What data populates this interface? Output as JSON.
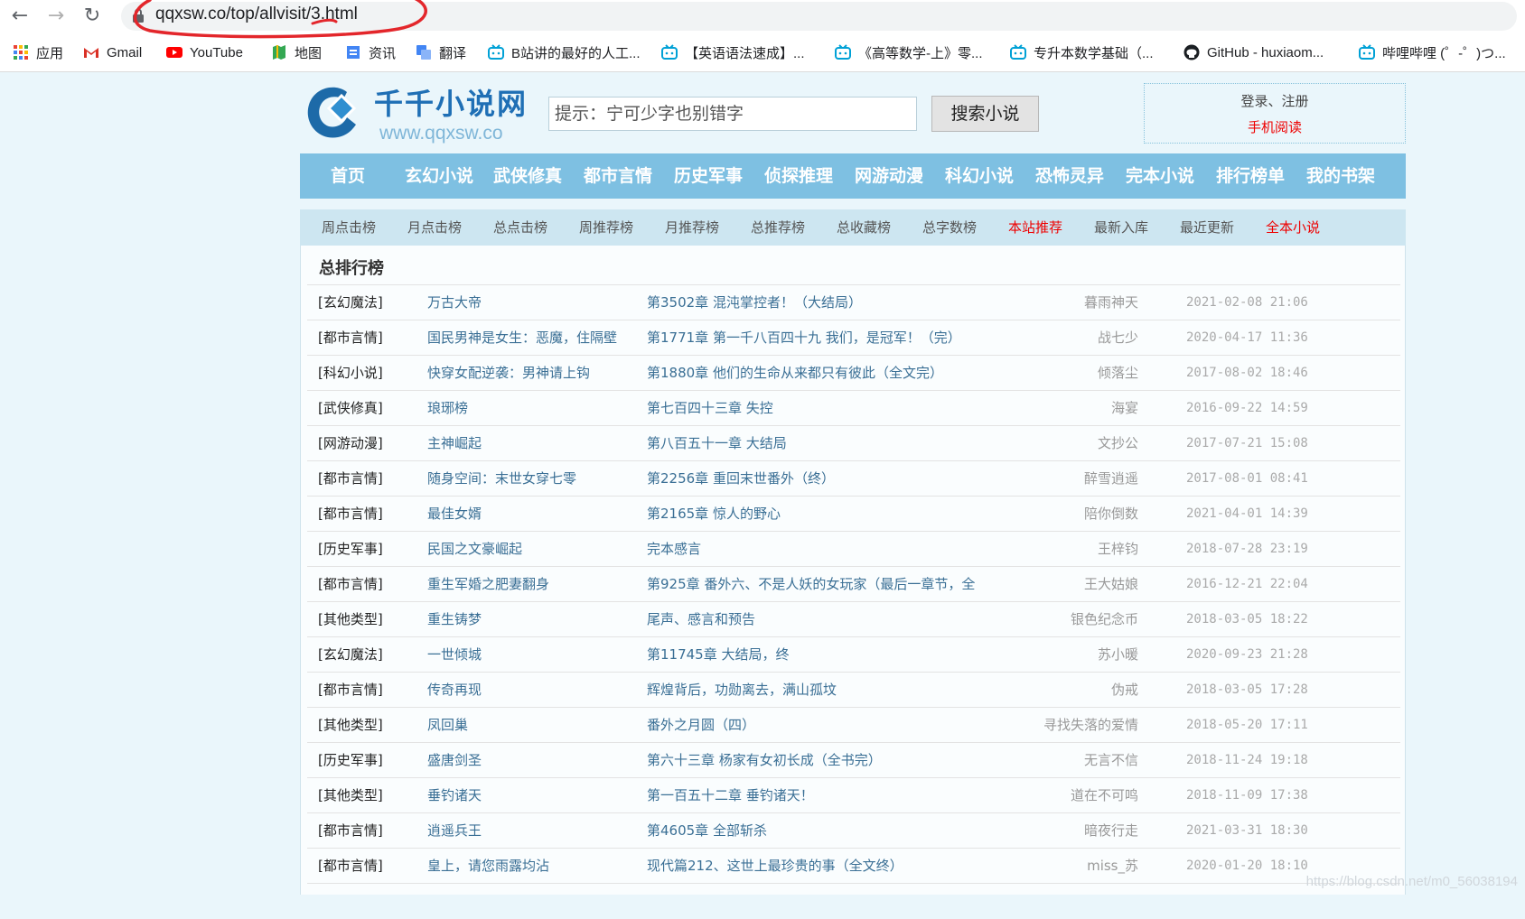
{
  "browser": {
    "url": "qqxsw.co/top/allvisit/3.html",
    "bookmarks": [
      "应用",
      "Gmail",
      "YouTube",
      "地图",
      "资讯",
      "翻译",
      "B站讲的最好的人工...",
      "【英语语法速成】...",
      "《高等数学-上》零...",
      "专升本数学基础（...",
      "GitHub - huxiaom...",
      "哔哩哔哩 (゜-゜)つ..."
    ]
  },
  "header": {
    "site_name": "千千小说网",
    "site_url": "www.qqxsw.co",
    "search_placeholder": "提示：宁可少字也别错字",
    "search_button": "搜索小说",
    "login_register": "登录、注册",
    "mobile_read": "手机阅读"
  },
  "main_nav": [
    "首页",
    "玄幻小说",
    "武侠修真",
    "都市言情",
    "历史军事",
    "侦探推理",
    "网游动漫",
    "科幻小说",
    "恐怖灵异",
    "完本小说",
    "排行榜单",
    "我的书架"
  ],
  "sub_nav": [
    "周点击榜",
    "月点击榜",
    "总点击榜",
    "周推荐榜",
    "月推荐榜",
    "总推荐榜",
    "总收藏榜",
    "总字数榜",
    "本站推荐",
    "最新入库",
    "最近更新",
    "全本小说"
  ],
  "ranking": {
    "title": "总排行榜",
    "rows": [
      {
        "cat": "[玄幻魔法]",
        "title": "万古大帝",
        "chapter": "第3502章 混沌掌控者！（大结局）",
        "author": "暮雨神天",
        "time": "2021-02-08 21:06"
      },
      {
        "cat": "[都市言情]",
        "title": "国民男神是女生：恶魔，住隔壁",
        "chapter": "第1771章 第一千八百四十九 我们，是冠军！（完）",
        "author": "战七少",
        "time": "2020-04-17 11:36"
      },
      {
        "cat": "[科幻小说]",
        "title": "快穿女配逆袭：男神请上钩",
        "chapter": "第1880章 他们的生命从来都只有彼此（全文完）",
        "author": "倾落尘",
        "time": "2017-08-02 18:46"
      },
      {
        "cat": "[武侠修真]",
        "title": "琅琊榜",
        "chapter": "第七百四十三章 失控",
        "author": "海宴",
        "time": "2016-09-22 14:59"
      },
      {
        "cat": "[网游动漫]",
        "title": "主神崛起",
        "chapter": "第八百五十一章 大结局",
        "author": "文抄公",
        "time": "2017-07-21 15:08"
      },
      {
        "cat": "[都市言情]",
        "title": "随身空间：末世女穿七零",
        "chapter": "第2256章 重回末世番外（终）",
        "author": "醉雪逍遥",
        "time": "2017-08-01 08:41"
      },
      {
        "cat": "[都市言情]",
        "title": "最佳女婿",
        "chapter": "第2165章 惊人的野心",
        "author": "陪你倒数",
        "time": "2021-04-01 14:39"
      },
      {
        "cat": "[历史军事]",
        "title": "民国之文豪崛起",
        "chapter": "完本感言",
        "author": "王梓钧",
        "time": "2018-07-28 23:19"
      },
      {
        "cat": "[都市言情]",
        "title": "重生军婚之肥妻翻身",
        "chapter": "第925章 番外六、不是人妖的女玩家（最后一章节，全",
        "author": "王大姑娘",
        "time": "2016-12-21 22:04"
      },
      {
        "cat": "[其他类型]",
        "title": "重生铸梦",
        "chapter": "尾声、感言和预告",
        "author": "银色纪念币",
        "time": "2018-03-05 18:22"
      },
      {
        "cat": "[玄幻魔法]",
        "title": "一世倾城",
        "chapter": "第11745章 大结局，终",
        "author": "苏小暖",
        "time": "2020-09-23 21:28"
      },
      {
        "cat": "[都市言情]",
        "title": "传奇再现",
        "chapter": "辉煌背后，功勋离去，满山孤坟",
        "author": "伪戒",
        "time": "2018-03-05 17:28"
      },
      {
        "cat": "[其他类型]",
        "title": "凤回巢",
        "chapter": "番外之月圆（四）",
        "author": "寻找失落的爱情",
        "time": "2018-05-20 17:11"
      },
      {
        "cat": "[历史军事]",
        "title": "盛唐剑圣",
        "chapter": "第六十三章 杨家有女初长成（全书完）",
        "author": "无言不信",
        "time": "2018-11-24 19:18"
      },
      {
        "cat": "[其他类型]",
        "title": "垂钓诸天",
        "chapter": "第一百五十二章 垂钓诸天！",
        "author": "道在不可鸣",
        "time": "2018-11-09 17:38"
      },
      {
        "cat": "[都市言情]",
        "title": "逍遥兵王",
        "chapter": "第4605章 全部斩杀",
        "author": "暗夜行走",
        "time": "2021-03-31 18:30"
      },
      {
        "cat": "[都市言情]",
        "title": "皇上，请您雨露均沾",
        "chapter": "现代篇212、这世上最珍贵的事（全文终）",
        "author": "miss_苏",
        "time": "2020-01-20 18:10"
      }
    ]
  },
  "watermark": "https://blog.csdn.net/m0_56038194",
  "colors": {
    "nav_bg": "#7ec0e2",
    "sub_nav_bg": "#cde6f1",
    "accent_red": "#ee0000",
    "link": "#3a6f95"
  }
}
